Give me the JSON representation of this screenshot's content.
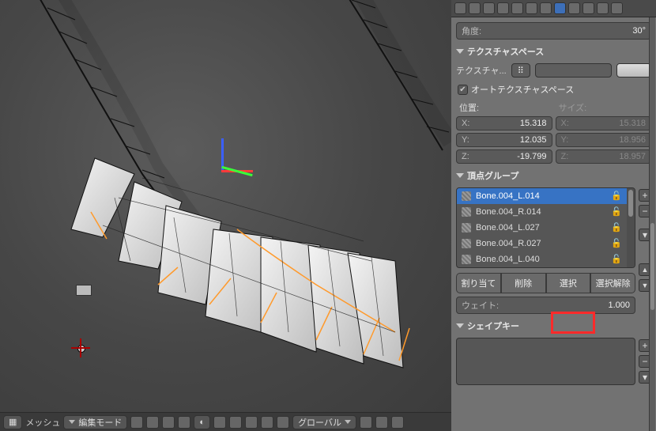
{
  "viewport": {
    "mode_label": "編集モード",
    "mesh_menu": "メッシュ",
    "orientation_label": "グローバル"
  },
  "panel": {
    "angle_label": "角度:",
    "angle_value": "30°",
    "tex_space_header": "テクスチャスペース",
    "tex_label": "テクスチャ...",
    "auto_tex_label": "オートテクスチャスペース",
    "position_label": "位置:",
    "size_label": "サイズ:",
    "pos": {
      "x": "15.318",
      "y": "12.035",
      "z": "-19.799"
    },
    "size": {
      "x": "15.318",
      "y": "18.956",
      "z": "18.957"
    },
    "vg_header": "頂点グループ",
    "vg_items": [
      "Bone.004_L.014",
      "Bone.004_R.014",
      "Bone.004_L.027",
      "Bone.004_R.027",
      "Bone.004_L.040"
    ],
    "assign": "割り当て",
    "remove": "削除",
    "select": "選択",
    "deselect": "選択解除",
    "weight_label": "ウェイト:",
    "weight_value": "1.000",
    "shapekey_header": "シェイプキー"
  }
}
